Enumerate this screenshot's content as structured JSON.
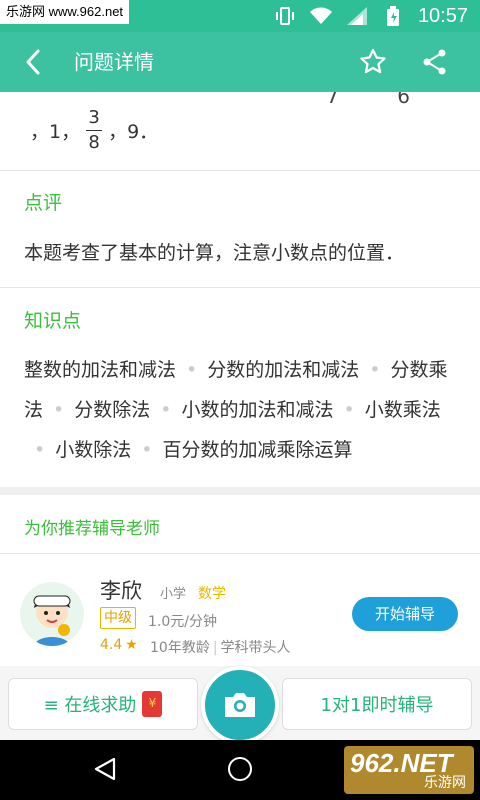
{
  "status_bar": {
    "watermark": "乐游网 www.962.net",
    "time": "10:57"
  },
  "app_bar": {
    "title": "问题详情"
  },
  "answer": {
    "clipped_text": "7 6",
    "prefix": "，1，",
    "fraction_num": "3",
    "fraction_den": "8",
    "suffix": "，9．"
  },
  "comment": {
    "heading": "点评",
    "text": "本题考查了基本的计算，注意小数点的位置．"
  },
  "knowledge": {
    "heading": "知识点",
    "tags": [
      "整数的加法和减法",
      "分数的加法和减法",
      "分数乘法",
      "分数除法",
      "小数的加法和减法",
      "小数乘法",
      "小数除法",
      "百分数的加减乘除运算"
    ],
    "separator": "•"
  },
  "recommend": {
    "heading": "为你推荐辅导老师",
    "teacher": {
      "name": "李欣",
      "level": "小学",
      "subject": "数学",
      "rank": "中级",
      "price": "1.0元/分钟",
      "rating": "4.4",
      "experience": "10年教龄",
      "title": "学科带头人",
      "action": "开始辅导"
    }
  },
  "bottom_bar": {
    "left_label": "≡ 在线求助",
    "right_label": "1对1即时辅导"
  },
  "nav_logo": {
    "big": "962.NET",
    "small": "乐游网"
  },
  "colors": {
    "app_bar": "#3cc2a1",
    "status_bar": "#2fbf97",
    "accent_green": "#3bbf3b",
    "button_blue": "#1fa0db",
    "camera": "#23b0b6"
  }
}
